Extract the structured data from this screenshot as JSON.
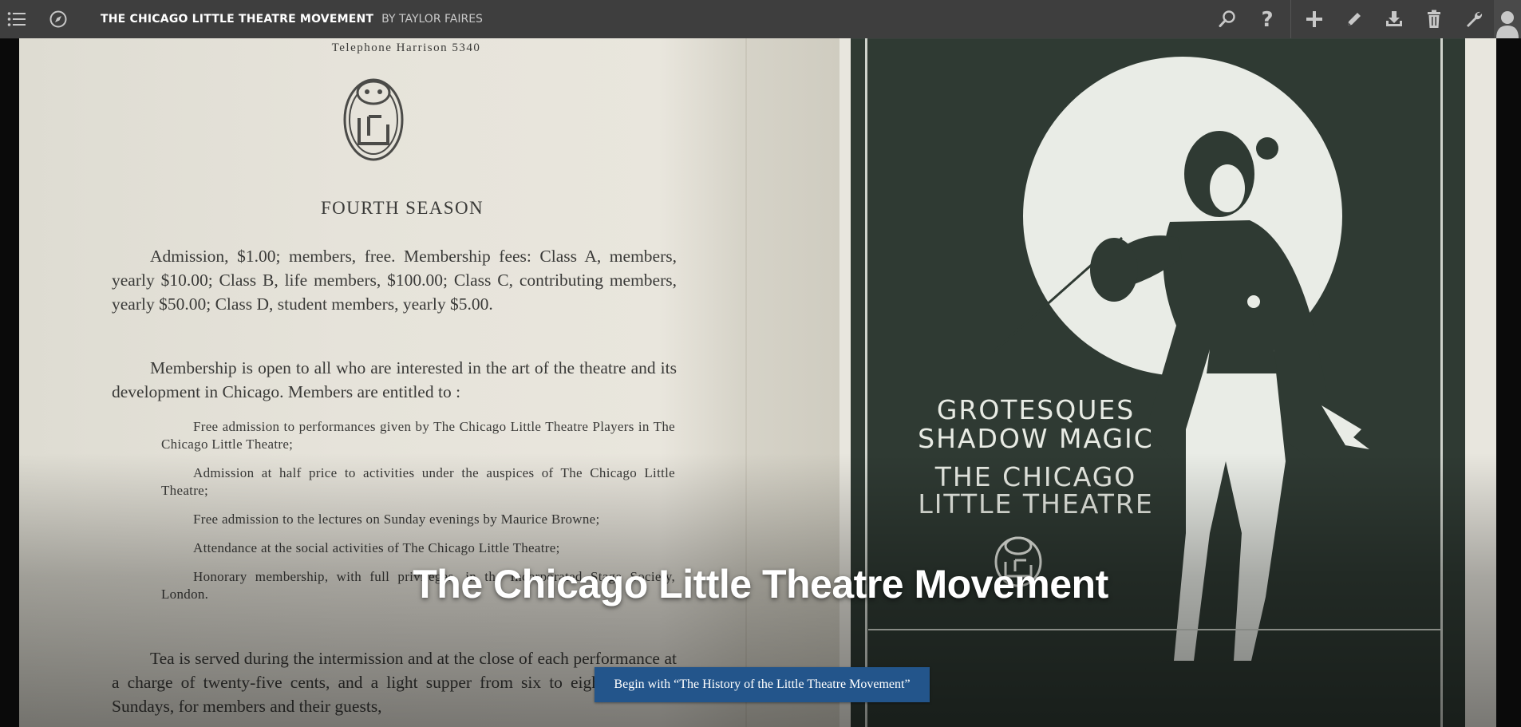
{
  "topbar": {
    "book_title": "THE CHICAGO LITTLE THEATRE MOVEMENT",
    "byline": "BY TAYLOR FAIRES",
    "icons_left": [
      "menu-list-icon",
      "compass-icon"
    ],
    "icons_right": [
      "search-icon",
      "help-icon",
      "add-icon",
      "edit-icon",
      "download-icon",
      "trash-icon",
      "wrench-icon",
      "user-avatar-icon"
    ]
  },
  "document": {
    "telephone": "Telephone Harrison 5340",
    "season": "FOURTH SEASON",
    "paragraph_1": "Admission, $1.00; members, free. Membership fees: Class A, members, yearly $10.00; Class B, life members, $100.00; Class C, contributing members, yearly $50.00; Class D, student members, yearly $5.00.",
    "paragraph_2": "Membership is open to all who are interested in the art of the theatre and its development in Chicago. Members are entitled to :",
    "benefits": [
      "Free admission to performances given by The Chicago Little Theatre Players in The Chicago Little Theatre;",
      "Admission at half price to activities under the auspices of The Chicago Little Theatre;",
      "Free admission to the lectures on Sunday evenings by Maurice Browne;",
      "Attendance at the social activities of The Chicago Little Theatre;",
      "Honorary membership, with full privileges, in the Incorporated Stage Society, London."
    ],
    "paragraph_3": "Tea is served during the intermission and at the close of each performance at a charge of twenty-five cents, and a light supper from six to eight p. m. on Sundays, for members and their guests,",
    "cover_line_1": "GROTESQUES",
    "cover_line_2": "SHADOW MAGIC",
    "cover_line_3": "THE CHICAGO",
    "cover_line_4": "LITTLE THEATRE"
  },
  "hero": {
    "title": "The Chicago Little Theatre Movement",
    "begin_button": "Begin with “The History of the Little Theatre Movement”"
  },
  "colors": {
    "topbar": "#3e3e3e",
    "button": "#23558b",
    "cover": "#2f3a33",
    "paper": "#e6e3da"
  }
}
